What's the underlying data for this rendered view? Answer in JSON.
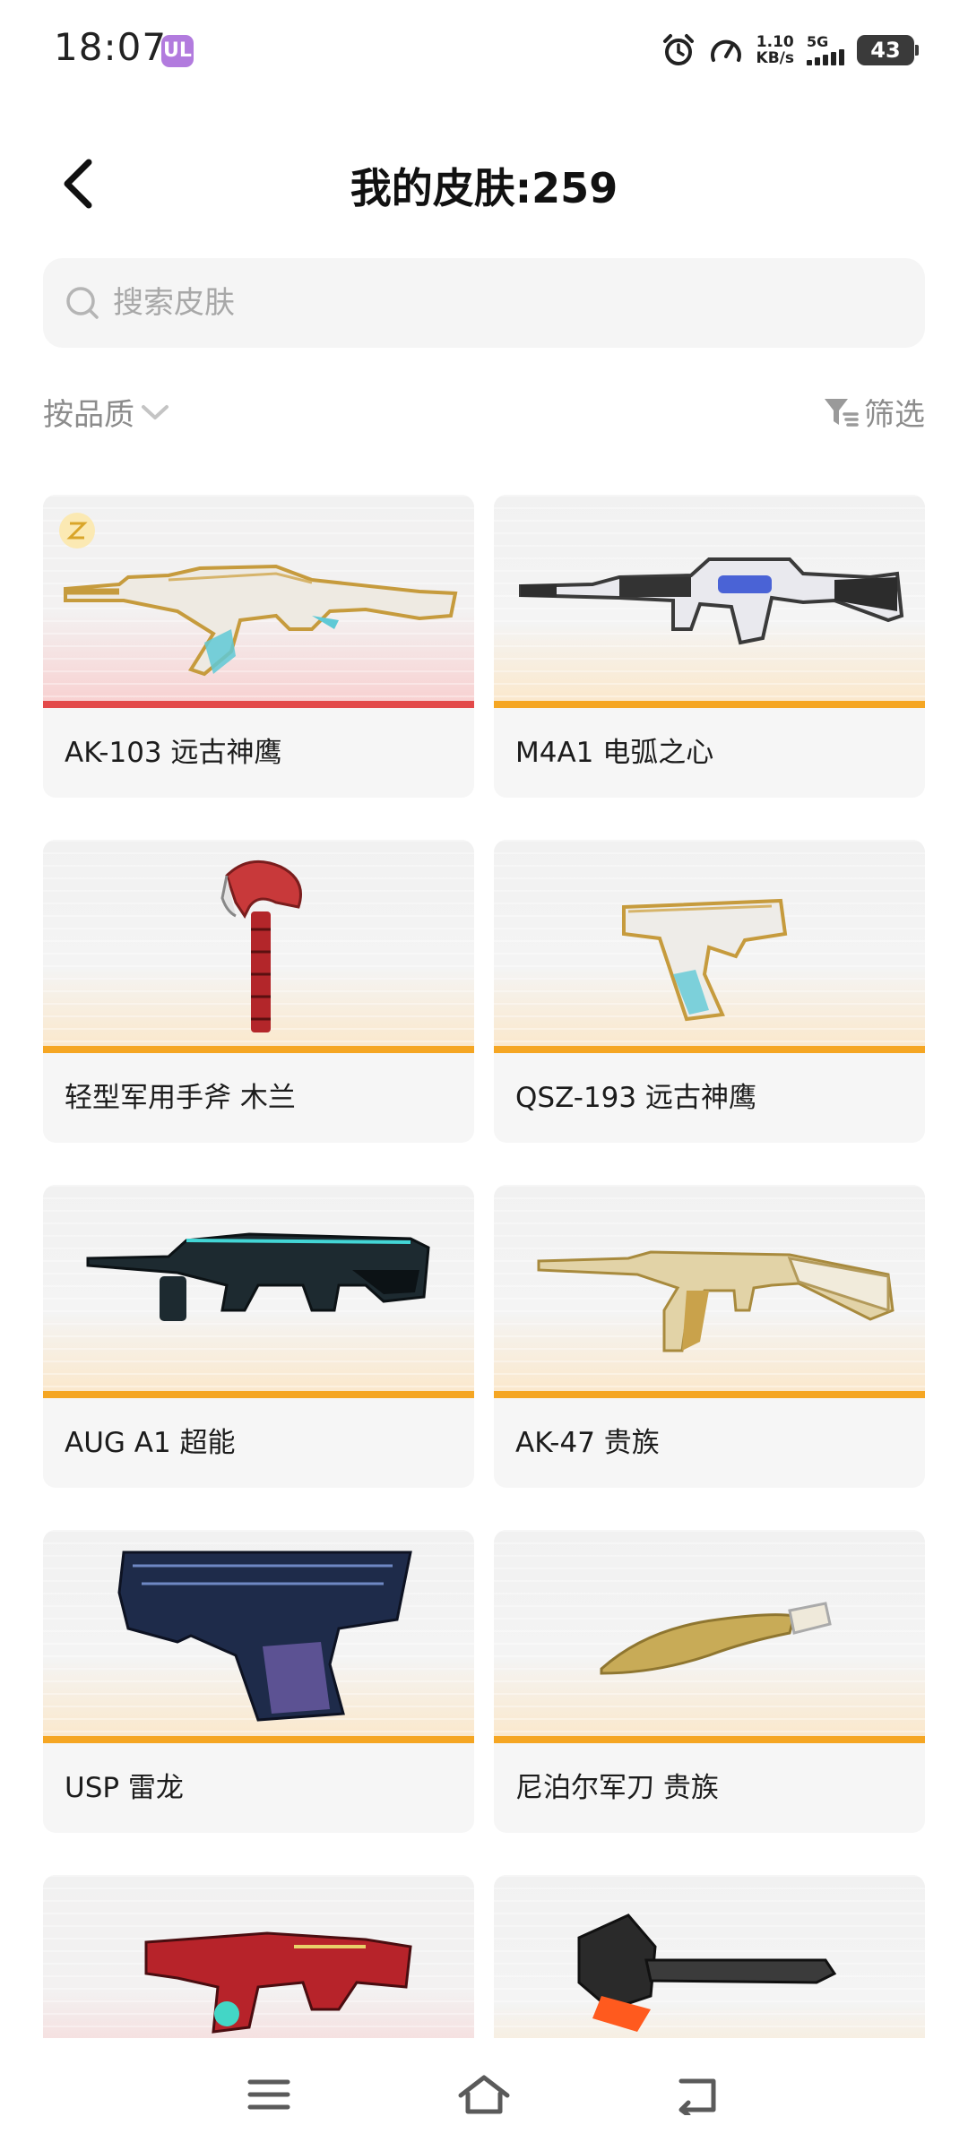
{
  "status_bar": {
    "time": "18:07",
    "app_badge": "UL",
    "speed_value": "1.10",
    "speed_unit": "KB/s",
    "network": "5G",
    "battery": "43"
  },
  "header": {
    "title": "我的皮肤:259"
  },
  "search": {
    "placeholder": "搜索皮肤"
  },
  "sort": {
    "label": "按品质"
  },
  "filter": {
    "label": "筛选"
  },
  "skins": [
    {
      "name": "AK-103 远古神鹰",
      "rarity_color": "#e34a4a",
      "icon": "assault-rifle-icon"
    },
    {
      "name": "M4A1 电弧之心",
      "rarity_color": "#f5a623",
      "icon": "assault-rifle-icon"
    },
    {
      "name": "轻型军用手斧 木兰",
      "rarity_color": "#f5a623",
      "icon": "hatchet-icon"
    },
    {
      "name": "QSZ-193 远古神鹰",
      "rarity_color": "#f5a623",
      "icon": "pistol-icon"
    },
    {
      "name": "AUG A1 超能",
      "rarity_color": "#f5a623",
      "icon": "bullpup-rifle-icon"
    },
    {
      "name": "AK-47 贵族",
      "rarity_color": "#f5a623",
      "icon": "assault-rifle-icon"
    },
    {
      "name": "USP 雷龙",
      "rarity_color": "#f5a623",
      "icon": "pistol-icon"
    },
    {
      "name": "尼泊尔军刀 贵族",
      "rarity_color": "#f5a623",
      "icon": "kukri-knife-icon"
    },
    {
      "name": "",
      "rarity_color": "#e34a4a",
      "icon": "smg-icon"
    },
    {
      "name": "",
      "rarity_color": "#f5a623",
      "icon": "melee-weapon-icon"
    }
  ],
  "nav": {
    "menu_icon": "menu-icon",
    "home_icon": "home-icon",
    "back_icon": "back-icon"
  }
}
